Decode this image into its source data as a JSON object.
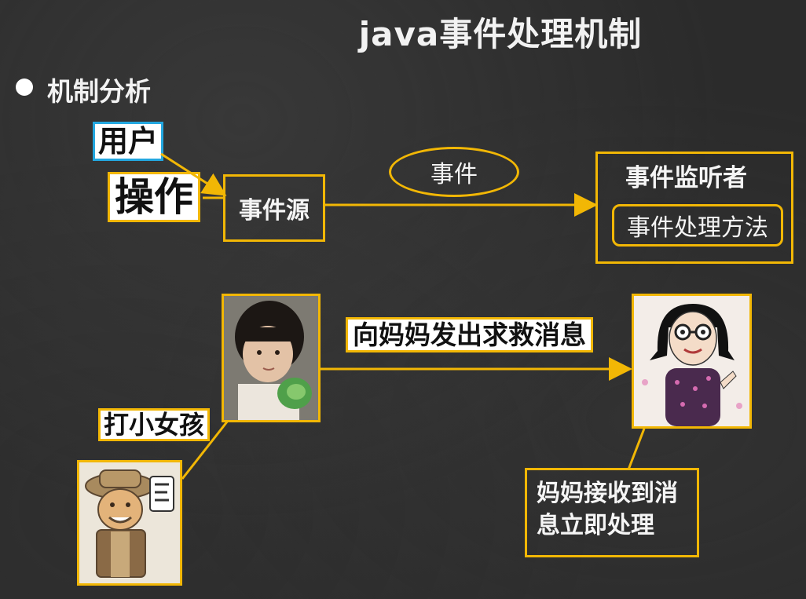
{
  "title": "java事件处理机制",
  "bullet": "机制分析",
  "diagram": {
    "user_label": "用户",
    "operation_label": "操作",
    "event_source": "事件源",
    "event": "事件",
    "listener_title": "事件监听者",
    "handler_method": "事件处理方法"
  },
  "example": {
    "hit_girl": "打小女孩",
    "call_mom": "向妈妈发出求救消息",
    "mom_handles": "妈妈接收到消息立即处理"
  },
  "colors": {
    "accent_yellow": "#f2b705",
    "user_blue": "#23a7e0",
    "background": "#2b2b2b"
  }
}
